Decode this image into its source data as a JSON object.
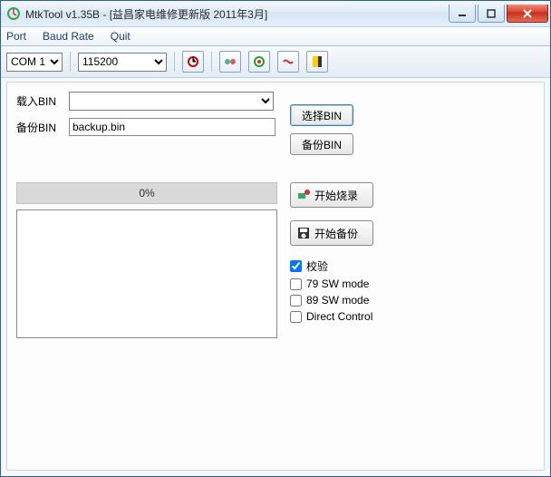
{
  "window": {
    "title": "MtkTool v1.35B - [益昌家电维修更新版  2011年3月]"
  },
  "menu": {
    "port": "Port",
    "baud": "Baud Rate",
    "quit": "Quit"
  },
  "toolbar": {
    "com_options": [
      "COM 1"
    ],
    "com_value": "COM 1",
    "baud_options": [
      "115200"
    ],
    "baud_value": "115200"
  },
  "form": {
    "load_label": "载入BIN",
    "load_value": "",
    "backup_label": "备份BIN",
    "backup_value": "backup.bin",
    "select_btn": "选择BIN",
    "backup_btn": "备份BIN"
  },
  "progress": {
    "text": "0%"
  },
  "actions": {
    "start_burn": "开始烧录",
    "start_backup": "开始备份"
  },
  "options": {
    "verify": "校验",
    "sw79": "79 SW mode",
    "sw89": "89 SW mode",
    "direct": "Direct Control",
    "verify_checked": true,
    "sw79_checked": false,
    "sw89_checked": false,
    "direct_checked": false
  }
}
